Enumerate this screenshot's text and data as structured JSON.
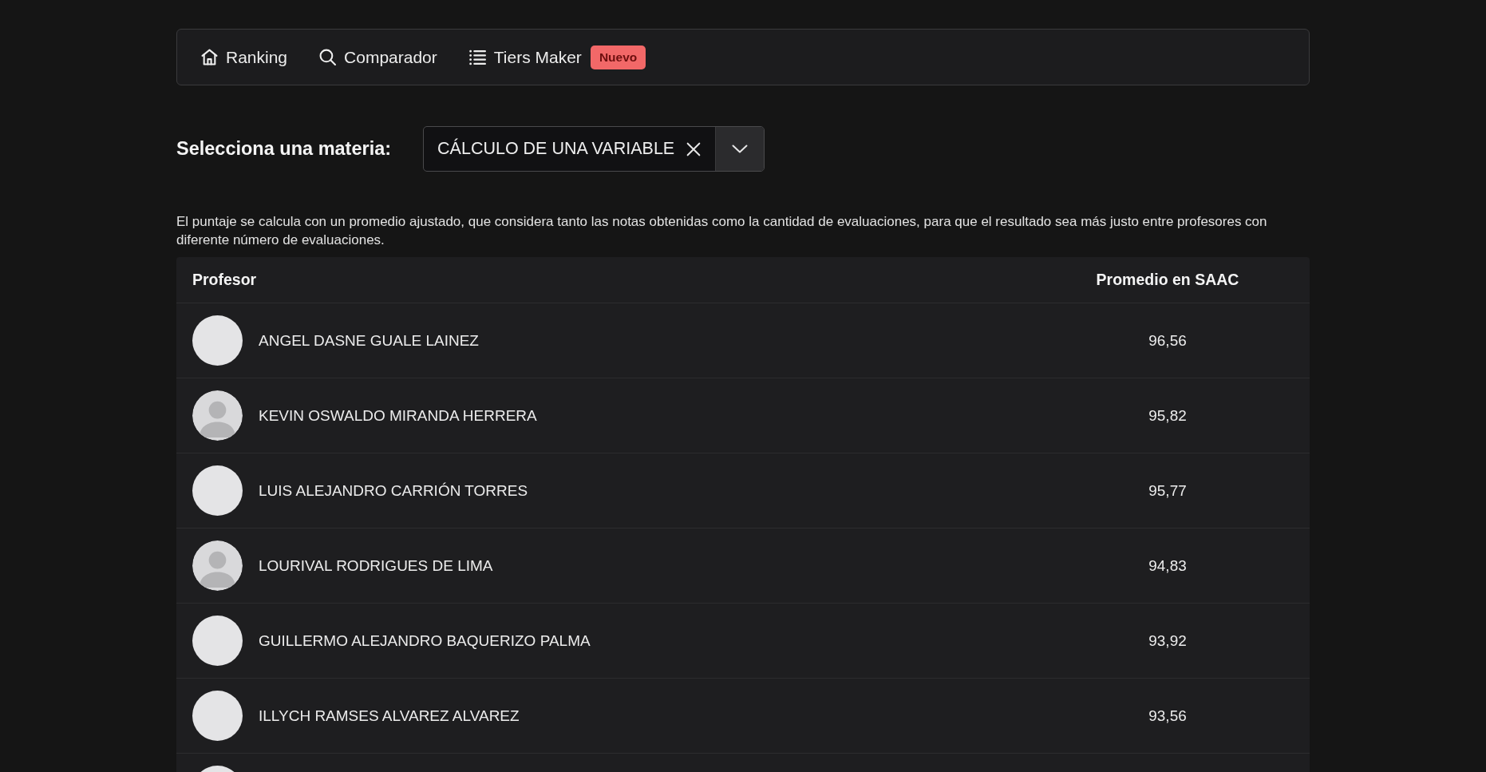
{
  "nav": {
    "items": [
      {
        "label": "Ranking"
      },
      {
        "label": "Comparador"
      },
      {
        "label": "Tiers Maker",
        "badge": "Nuevo"
      }
    ]
  },
  "subject_select": {
    "label": "Selecciona una materia:",
    "value": "CÁLCULO DE UNA VARIABLE"
  },
  "description": "El puntaje se calcula con un promedio ajustado, que considera tanto las notas obtenidas como la cantidad de evaluaciones, para que el resultado sea más justo entre profesores con diferente número de evaluaciones.",
  "table": {
    "columns": [
      "Profesor",
      "Promedio en SAAC"
    ],
    "rows": [
      {
        "avatar": {
          "kind": "photo"
        },
        "name": "ANGEL DASNE GUALE LAINEZ",
        "score": "96,56"
      },
      {
        "avatar": {
          "kind": "placeholder"
        },
        "name": "KEVIN OSWALDO MIRANDA HERRERA",
        "score": "95,82"
      },
      {
        "avatar": {
          "kind": "photo"
        },
        "name": "LUIS ALEJANDRO CARRIÓN TORRES",
        "score": "95,77"
      },
      {
        "avatar": {
          "kind": "placeholder"
        },
        "name": "LOURIVAL RODRIGUES DE LIMA",
        "score": "94,83"
      },
      {
        "avatar": {
          "kind": "photo"
        },
        "name": "GUILLERMO ALEJANDRO BAQUERIZO PALMA",
        "score": "93,92"
      },
      {
        "avatar": {
          "kind": "photo"
        },
        "name": "ILLYCH RAMSES ALVAREZ ALVAREZ",
        "score": "93,56"
      },
      {
        "avatar": {
          "kind": "photo"
        }
      }
    ]
  }
}
